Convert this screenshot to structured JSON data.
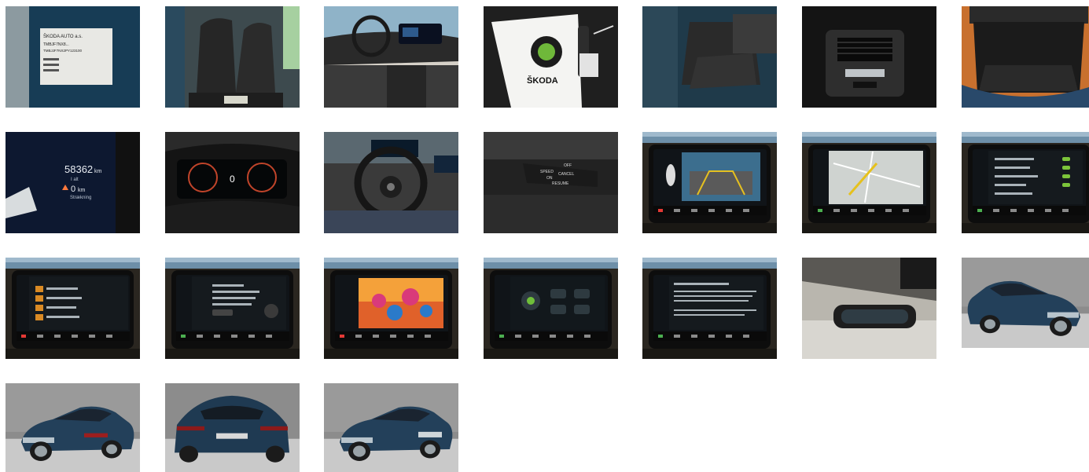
{
  "gallery": {
    "photos": [
      {
        "subject": "vin-plate",
        "plate_text": [
          "ŠKODA AUTO a.s.",
          "TMBJF7NX8...",
          "TMBJJF7NX2PY123100"
        ]
      },
      {
        "subject": "front-seats"
      },
      {
        "subject": "dashboard"
      },
      {
        "subject": "key-fob",
        "brand_text": "ŠKODA"
      },
      {
        "subject": "rear-seats"
      },
      {
        "subject": "rear-air-vents"
      },
      {
        "subject": "trunk"
      },
      {
        "subject": "odometer",
        "mileage": "58362",
        "mileage_unit": "km",
        "trip_label": "I alt",
        "range_value": "0",
        "range_unit": "km",
        "range_label": "Strækning"
      },
      {
        "subject": "digital-cockpit",
        "center_value": "0"
      },
      {
        "subject": "steering-wheel"
      },
      {
        "subject": "cruise-control-stalk",
        "stalk_labels": [
          "OFF",
          "SPEED",
          "CANCEL",
          "ON",
          "RESUME"
        ]
      },
      {
        "subject": "park-assist-screen"
      },
      {
        "subject": "navigation-screen"
      },
      {
        "subject": "settings-screen"
      },
      {
        "subject": "radio-screen"
      },
      {
        "subject": "phone-screen"
      },
      {
        "subject": "media-screen"
      },
      {
        "subject": "climate-screen"
      },
      {
        "subject": "info-screen"
      },
      {
        "subject": "rear-view-mirror"
      },
      {
        "subject": "exterior-front-right"
      },
      {
        "subject": "exterior-rear-left"
      },
      {
        "subject": "exterior-rear"
      },
      {
        "subject": "exterior-front-left"
      }
    ]
  }
}
